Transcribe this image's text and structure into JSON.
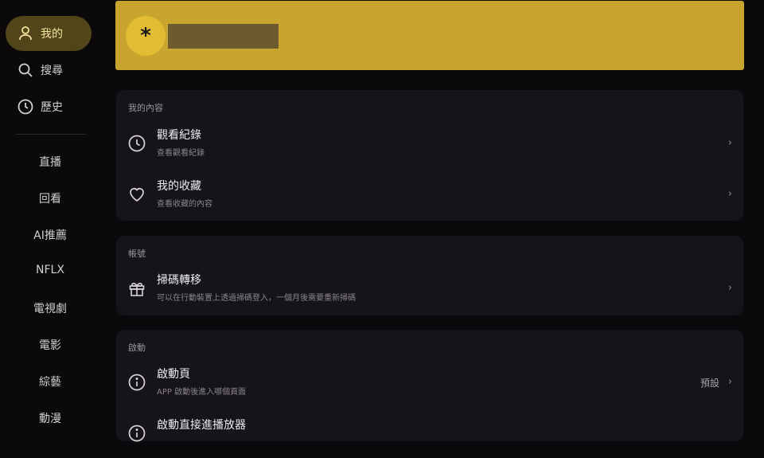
{
  "sidebar": {
    "items": [
      {
        "label": "我的",
        "icon": "person-icon",
        "active": true
      },
      {
        "label": "搜尋",
        "icon": "search-icon"
      },
      {
        "label": "歷史",
        "icon": "clock-icon"
      }
    ],
    "categories": [
      "直播",
      "回看",
      "AI推薦",
      "NFLX",
      "電視劇",
      "電影",
      "綜藝",
      "動漫"
    ]
  },
  "profile": {
    "avatar_text": "*",
    "accent": "#c7a52f"
  },
  "sections": [
    {
      "header": "我的內容",
      "rows": [
        {
          "title": "觀看紀錄",
          "subtitle": "查看觀看紀錄",
          "icon": "clock-icon"
        },
        {
          "title": "我的收藏",
          "subtitle": "查看收藏的內容",
          "icon": "heart-icon"
        }
      ]
    },
    {
      "header": "帳號",
      "rows": [
        {
          "title": "掃碼轉移",
          "subtitle": "可以在行動裝置上透過掃碼登入，一個月後需要重新掃碼",
          "icon": "gift-icon"
        }
      ]
    },
    {
      "header": "啟動",
      "rows": [
        {
          "title": "啟動頁",
          "subtitle": "APP 啟動後進入哪個頁面",
          "value": "預設",
          "icon": "info-icon"
        },
        {
          "title": "啟動直接進播放器",
          "subtitle": "",
          "value": "",
          "icon": "info-icon"
        }
      ]
    }
  ],
  "chevron": "›"
}
